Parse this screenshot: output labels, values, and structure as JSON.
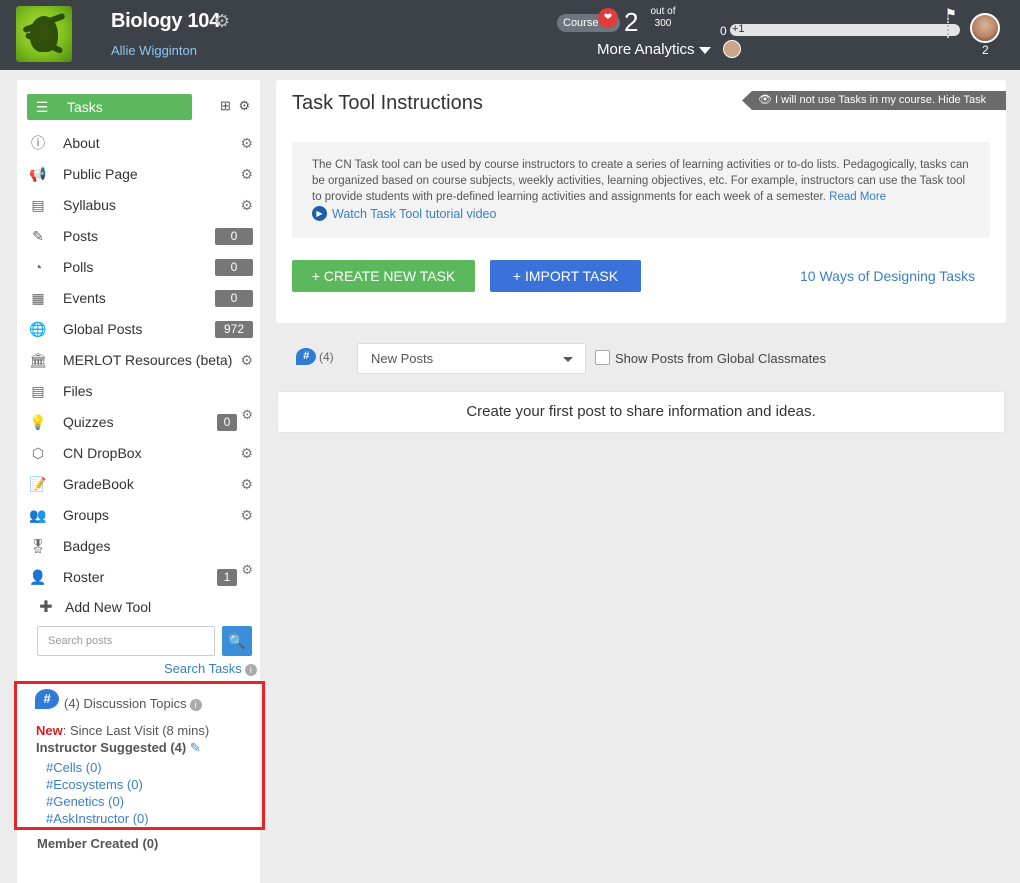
{
  "header": {
    "course_title": "Biology 104",
    "instructor_name": "Allie Wigginton",
    "course_pill": "Course",
    "course_badge": "❤",
    "score": "2",
    "out_of_label": "out of",
    "out_of_total": "300",
    "more_analytics": "More Analytics",
    "progress_start": "0",
    "progress_plus": "+1",
    "progress_fraction": 0.0067,
    "user_count": "2"
  },
  "sidebar": {
    "items": [
      {
        "label": "Tasks",
        "icon": "list-icon"
      },
      {
        "label": "About",
        "icon": "info-icon"
      },
      {
        "label": "Public Page",
        "icon": "megaphone-icon"
      },
      {
        "label": "Syllabus",
        "icon": "document-icon"
      },
      {
        "label": "Posts",
        "icon": "edit-icon",
        "count": "0"
      },
      {
        "label": "Polls",
        "icon": "pie-chart-icon",
        "count": "0"
      },
      {
        "label": "Events",
        "icon": "calendar-icon",
        "count": "0"
      },
      {
        "label": "Global Posts",
        "icon": "globe-icon",
        "count": "972"
      },
      {
        "label": "MERLOT Resources (beta)",
        "icon": "building-icon"
      },
      {
        "label": "Files",
        "icon": "file-icon"
      },
      {
        "label": "Quizzes",
        "icon": "lightbulb-icon",
        "count": "0"
      },
      {
        "label": "CN DropBox",
        "icon": "box-icon"
      },
      {
        "label": "GradeBook",
        "icon": "gradebook-icon"
      },
      {
        "label": "Groups",
        "icon": "users-icon"
      },
      {
        "label": "Badges",
        "icon": "badge-icon"
      },
      {
        "label": "Roster",
        "icon": "user-icon",
        "count": "1"
      }
    ],
    "add_tool": "Add New Tool",
    "search_placeholder": "Search posts",
    "search_tasks": "Search Tasks",
    "discussion": {
      "title": "(4) Discussion Topics",
      "new_label": "New",
      "since_last_visit": ": Since Last Visit (8 mins)",
      "instructor_suggested": "Instructor Suggested (4)",
      "topics": [
        "#Cells  (0)",
        "#Ecosystems  (0)",
        "#Genetics  (0)",
        "#AskInstructor  (0)"
      ],
      "member_created": "Member Created (0)"
    }
  },
  "main": {
    "title": "Task Tool Instructions",
    "hide_task_tool": "I will not use Tasks in my course. Hide Task Tool",
    "info_text": "The CN Task tool can be used by course instructors to create a series of learning activities or to-do lists. Pedagogically, tasks can be organized based on course subjects, weekly activities, learning objectives, etc. For example, instructors can use the Task tool to provide students with pre-defined learning activities and assignments for each week of a semester.",
    "read_more": "Read More",
    "watch_video": "Watch Task Tool tutorial video",
    "create_task": "+ CREATE NEW TASK",
    "import_task": "+ IMPORT TASK",
    "ways_link": "10 Ways of Designing Tasks"
  },
  "feed": {
    "count": "(4)",
    "select_value": "New Posts",
    "global_label": "Show Posts from Global Classmates",
    "empty_message": "Create your first post to share information and ideas."
  },
  "colors": {
    "header_bg": "#3d4249",
    "accent_green": "#5cb85c",
    "accent_blue": "#3b72d9",
    "link_blue": "#3a7fc1",
    "highlight_red": "#e4262b"
  }
}
